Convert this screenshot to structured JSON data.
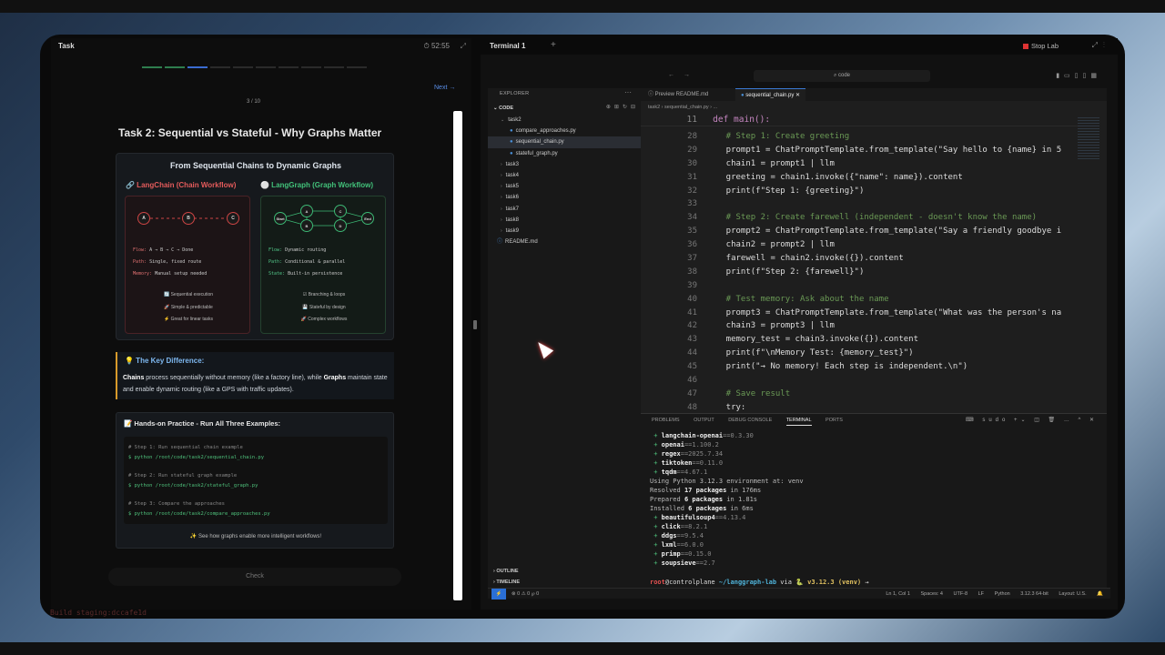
{
  "task_panel": {
    "title": "Task",
    "timer": "52:55",
    "next": "Next →",
    "progress_text": "3 / 10",
    "heading": "Task 2: Sequential vs Stateful - Why Graphs Matter",
    "card_title": "From Sequential Chains to Dynamic Graphs",
    "langchain": {
      "header": "🔗 LangChain (Chain Workflow)",
      "nodes": [
        "A",
        "B",
        "C"
      ],
      "flow": "A → B → C → Done",
      "path": "Single, fixed route",
      "memory": "Manual setup needed",
      "perks": [
        "🔄 Sequential execution",
        "🚀 Simple & predictable",
        "⚡ Great for linear tasks"
      ]
    },
    "langgraph": {
      "header": "⚪ LangGraph (Graph Workflow)",
      "nodes": [
        "Start",
        "A",
        "B",
        "C",
        "D",
        "End"
      ],
      "flow": "Dynamic routing",
      "path": "Conditional & parallel",
      "state": "Built-in persistence",
      "perks": [
        "☑ Branching & loops",
        "💾 Stateful by design",
        "🚀 Complex workflows"
      ]
    },
    "labels": {
      "flow": "Flow:",
      "path": "Path:",
      "memory": "Memory:",
      "state": "State:"
    },
    "key_difference": {
      "title": "💡 The Key Difference:",
      "chains_word": "Chains",
      "part1": " process sequentially without memory (like a factory line), while ",
      "graphs_word": "Graphs",
      "part2": " maintain state and enable dynamic routing (like a GPS with traffic updates)."
    },
    "hands_on": {
      "title": "📝 Hands-on Practice - Run All Three Examples:",
      "lines": [
        {
          "comment": "# Step 1: Run sequential chain example",
          "cmd": "$ python /root/code/task2/sequential_chain.py"
        },
        {
          "comment": "# Step 2: Run stateful graph example",
          "cmd": "$ python /root/code/task2/stateful_graph.py"
        },
        {
          "comment": "# Step 3: Compare the approaches",
          "cmd": "$ python /root/code/task2/compare_approaches.py"
        }
      ],
      "footer": "✨ See how graphs enable more intelligent workflows!"
    },
    "check": "Check",
    "build_tag": "Build staging:dccafe1d"
  },
  "terminal_window": {
    "tab": "Terminal 1",
    "stop": "Stop Lab",
    "command_center": "⌕ code"
  },
  "explorer": {
    "header": "EXPLORER",
    "root": "CODE",
    "items": [
      {
        "label": "task2",
        "type": "folder-open",
        "depth": 1
      },
      {
        "label": "compare_approaches.py",
        "type": "file",
        "depth": 2
      },
      {
        "label": "sequential_chain.py",
        "type": "file",
        "depth": 2,
        "selected": true
      },
      {
        "label": "stateful_graph.py",
        "type": "file",
        "depth": 2
      },
      {
        "label": "task3",
        "type": "folder",
        "depth": 1
      },
      {
        "label": "task4",
        "type": "folder",
        "depth": 1
      },
      {
        "label": "task5",
        "type": "folder",
        "depth": 1
      },
      {
        "label": "task6",
        "type": "folder",
        "depth": 1
      },
      {
        "label": "task7",
        "type": "folder",
        "depth": 1
      },
      {
        "label": "task8",
        "type": "folder",
        "depth": 1
      },
      {
        "label": "task9",
        "type": "folder",
        "depth": 1
      },
      {
        "label": "README.md",
        "type": "file",
        "depth": 1
      }
    ],
    "outline": "OUTLINE",
    "timeline": "TIMELINE"
  },
  "editor": {
    "tabs": [
      "Preview README.md",
      "sequential_chain.py"
    ],
    "breadcrumb": "task2 › sequential_chain.py › ...",
    "sticky": {
      "num": "11",
      "text": "def main():"
    },
    "lines": [
      {
        "num": "28",
        "text": "    # Step 1: Create greeting"
      },
      {
        "num": "29",
        "text": "    prompt1 = ChatPromptTemplate.from_template(\"Say hello to {name} in 5"
      },
      {
        "num": "30",
        "text": "    chain1 = prompt1 | llm"
      },
      {
        "num": "31",
        "text": "    greeting = chain1.invoke({\"name\": name}).content"
      },
      {
        "num": "32",
        "text": "    print(f\"Step 1: {greeting}\")"
      },
      {
        "num": "33",
        "text": ""
      },
      {
        "num": "34",
        "text": "    # Step 2: Create farewell (independent - doesn't know the name)"
      },
      {
        "num": "35",
        "text": "    prompt2 = ChatPromptTemplate.from_template(\"Say a friendly goodbye i"
      },
      {
        "num": "36",
        "text": "    chain2 = prompt2 | llm"
      },
      {
        "num": "37",
        "text": "    farewell = chain2.invoke({}).content"
      },
      {
        "num": "38",
        "text": "    print(f\"Step 2: {farewell}\")"
      },
      {
        "num": "39",
        "text": ""
      },
      {
        "num": "40",
        "text": "    # Test memory: Ask about the name"
      },
      {
        "num": "41",
        "text": "    prompt3 = ChatPromptTemplate.from_template(\"What was the person's na"
      },
      {
        "num": "42",
        "text": "    chain3 = prompt3 | llm"
      },
      {
        "num": "43",
        "text": "    memory_test = chain3.invoke({}).content"
      },
      {
        "num": "44",
        "text": "    print(f\"\\nMemory Test: {memory_test}\")"
      },
      {
        "num": "45",
        "text": "    print(\"→ No memory! Each step is independent.\\n\")"
      },
      {
        "num": "46",
        "text": ""
      },
      {
        "num": "47",
        "text": "    # Save result"
      },
      {
        "num": "48",
        "text": "    try:"
      }
    ]
  },
  "panel": {
    "tabs": [
      "PROBLEMS",
      "OUTPUT",
      "DEBUG CONSOLE",
      "TERMINAL",
      "PORTS"
    ],
    "active": "TERMINAL",
    "shell": "sudo",
    "prompt": {
      "user": "root",
      "host": "@controlplane",
      "path": " ~/langgraph-lab",
      "via": " via 🐍 ",
      "ver": "v3.12.3",
      "venv": " (venv)",
      "arrow": " →"
    }
  },
  "statusbar": {
    "remote": "⚡",
    "errors": "⊗ 0 ⚠ 0    ℘ 0",
    "position": "Ln 1, Col 1",
    "spaces": "Spaces: 4",
    "encoding": "UTF-8",
    "eol": "LF",
    "lang": "Python",
    "interpreter": "3.12.3 64-bit",
    "layout": "Layout: U.S."
  }
}
